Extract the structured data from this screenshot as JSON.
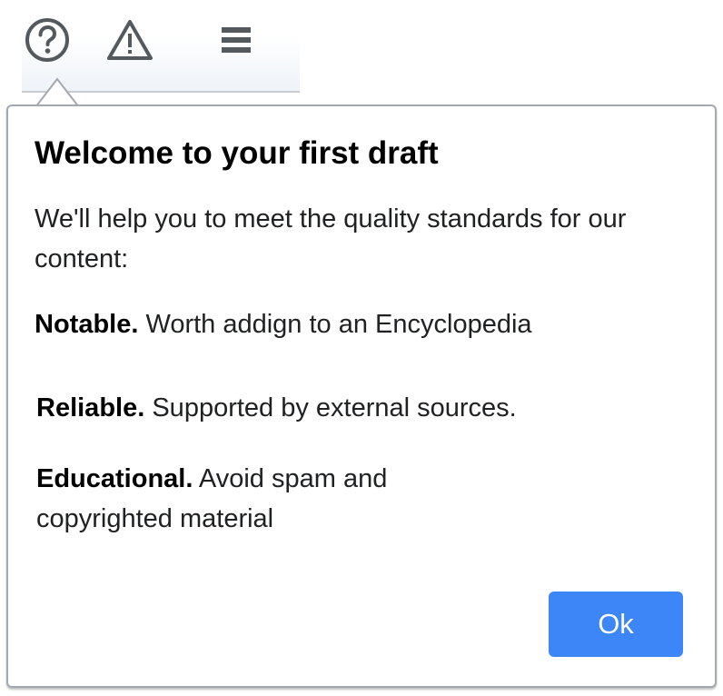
{
  "toolbar": {
    "icons": [
      "help-icon",
      "warning-icon",
      "menu-icon"
    ]
  },
  "popup": {
    "title": "Welcome to your first draft",
    "intro": "We'll help you to meet the quality standards for our content:",
    "items": [
      {
        "label": "Notable.",
        "text": "Worth addign to an Encyclopedia"
      },
      {
        "label": "Reliable.",
        "text": "Supported by external sources."
      },
      {
        "label": "Educational.",
        "text": "Avoid spam and copyrighted material"
      }
    ],
    "ok_label": "Ok"
  },
  "colors": {
    "button": "#3d86f7",
    "icon": "#54595d",
    "border": "#a2a9b1"
  }
}
